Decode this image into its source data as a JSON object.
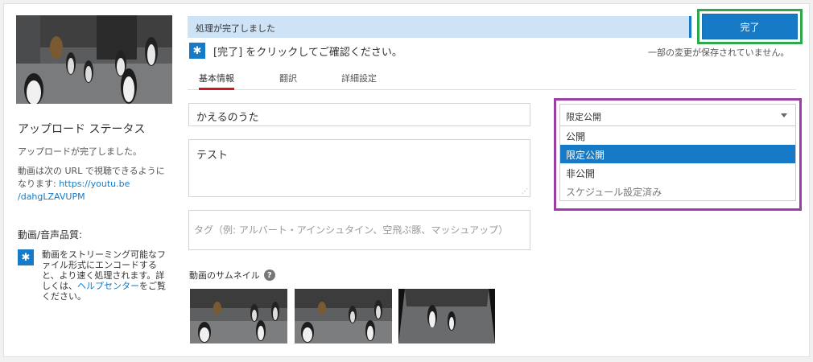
{
  "status": {
    "progress_text": "処理が完了しました",
    "done_label": "完了",
    "confirm_text": "[完了] をクリックしてご確認ください。",
    "not_saved_text": "一部の変更が保存されていません。"
  },
  "tabs": [
    {
      "label": "基本情報"
    },
    {
      "label": "翻訳"
    },
    {
      "label": "詳細設定"
    }
  ],
  "active_tab": "基本情報",
  "form": {
    "title_value": "かえるのうた",
    "description_value": "テスト",
    "tags_placeholder": "タグ（例: アルバート・アインシュタイン、空飛ぶ豚、マッシュアップ）"
  },
  "thumbnails": {
    "label": "動画のサムネイル"
  },
  "privacy": {
    "selected": "限定公開",
    "options": [
      {
        "label": "公開"
      },
      {
        "label": "限定公開"
      },
      {
        "label": "非公開"
      },
      {
        "label": "スケジュール設定済み"
      }
    ]
  },
  "sidebar": {
    "upload_status_title": "アップロード ステータス",
    "upload_done": "アップロードが完了しました。",
    "url_prefix": "動画は次の URL で視聴できるようになります: ",
    "url_line1": "https://youtu.be",
    "url_line2": "/dahgLZAVUPM",
    "quality_title": "動画/音声品質:",
    "quality_text_before": "動画をストリーミング可能なファイル形式にエンコードすると、より速く処理されます。詳しくは、",
    "help_center_link": "ヘルプセンター",
    "quality_text_after": "をご覧ください。"
  },
  "colors": {
    "accent_blue": "#167ac6",
    "tab_underline": "#cc181e",
    "done_highlight": "#2ea84a",
    "privacy_highlight": "#9b3fa6"
  }
}
